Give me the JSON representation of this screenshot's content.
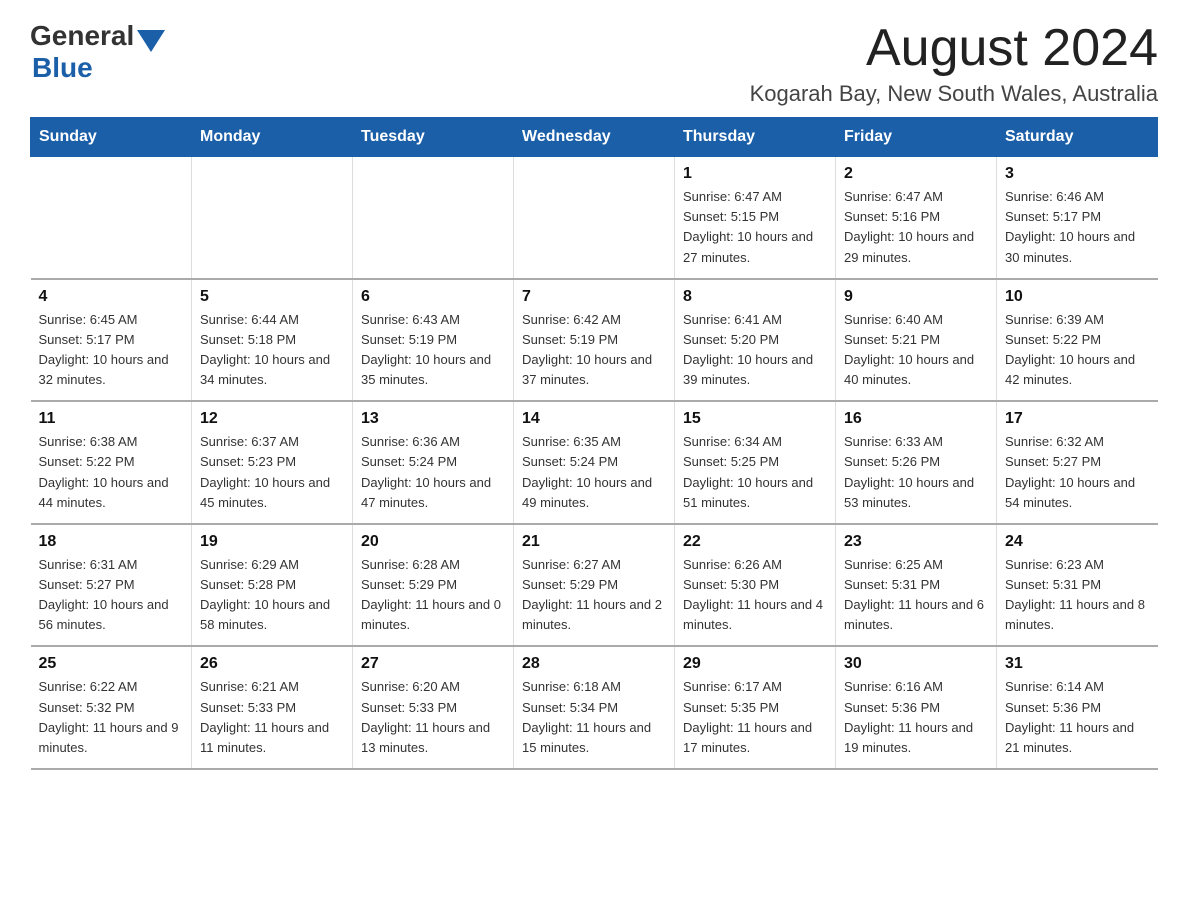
{
  "header": {
    "logo_general": "General",
    "logo_blue": "Blue",
    "month_title": "August 2024",
    "location": "Kogarah Bay, New South Wales, Australia"
  },
  "weekdays": [
    "Sunday",
    "Monday",
    "Tuesday",
    "Wednesday",
    "Thursday",
    "Friday",
    "Saturday"
  ],
  "weeks": [
    [
      {
        "day": "",
        "info": ""
      },
      {
        "day": "",
        "info": ""
      },
      {
        "day": "",
        "info": ""
      },
      {
        "day": "",
        "info": ""
      },
      {
        "day": "1",
        "info": "Sunrise: 6:47 AM\nSunset: 5:15 PM\nDaylight: 10 hours and 27 minutes."
      },
      {
        "day": "2",
        "info": "Sunrise: 6:47 AM\nSunset: 5:16 PM\nDaylight: 10 hours and 29 minutes."
      },
      {
        "day": "3",
        "info": "Sunrise: 6:46 AM\nSunset: 5:17 PM\nDaylight: 10 hours and 30 minutes."
      }
    ],
    [
      {
        "day": "4",
        "info": "Sunrise: 6:45 AM\nSunset: 5:17 PM\nDaylight: 10 hours and 32 minutes."
      },
      {
        "day": "5",
        "info": "Sunrise: 6:44 AM\nSunset: 5:18 PM\nDaylight: 10 hours and 34 minutes."
      },
      {
        "day": "6",
        "info": "Sunrise: 6:43 AM\nSunset: 5:19 PM\nDaylight: 10 hours and 35 minutes."
      },
      {
        "day": "7",
        "info": "Sunrise: 6:42 AM\nSunset: 5:19 PM\nDaylight: 10 hours and 37 minutes."
      },
      {
        "day": "8",
        "info": "Sunrise: 6:41 AM\nSunset: 5:20 PM\nDaylight: 10 hours and 39 minutes."
      },
      {
        "day": "9",
        "info": "Sunrise: 6:40 AM\nSunset: 5:21 PM\nDaylight: 10 hours and 40 minutes."
      },
      {
        "day": "10",
        "info": "Sunrise: 6:39 AM\nSunset: 5:22 PM\nDaylight: 10 hours and 42 minutes."
      }
    ],
    [
      {
        "day": "11",
        "info": "Sunrise: 6:38 AM\nSunset: 5:22 PM\nDaylight: 10 hours and 44 minutes."
      },
      {
        "day": "12",
        "info": "Sunrise: 6:37 AM\nSunset: 5:23 PM\nDaylight: 10 hours and 45 minutes."
      },
      {
        "day": "13",
        "info": "Sunrise: 6:36 AM\nSunset: 5:24 PM\nDaylight: 10 hours and 47 minutes."
      },
      {
        "day": "14",
        "info": "Sunrise: 6:35 AM\nSunset: 5:24 PM\nDaylight: 10 hours and 49 minutes."
      },
      {
        "day": "15",
        "info": "Sunrise: 6:34 AM\nSunset: 5:25 PM\nDaylight: 10 hours and 51 minutes."
      },
      {
        "day": "16",
        "info": "Sunrise: 6:33 AM\nSunset: 5:26 PM\nDaylight: 10 hours and 53 minutes."
      },
      {
        "day": "17",
        "info": "Sunrise: 6:32 AM\nSunset: 5:27 PM\nDaylight: 10 hours and 54 minutes."
      }
    ],
    [
      {
        "day": "18",
        "info": "Sunrise: 6:31 AM\nSunset: 5:27 PM\nDaylight: 10 hours and 56 minutes."
      },
      {
        "day": "19",
        "info": "Sunrise: 6:29 AM\nSunset: 5:28 PM\nDaylight: 10 hours and 58 minutes."
      },
      {
        "day": "20",
        "info": "Sunrise: 6:28 AM\nSunset: 5:29 PM\nDaylight: 11 hours and 0 minutes."
      },
      {
        "day": "21",
        "info": "Sunrise: 6:27 AM\nSunset: 5:29 PM\nDaylight: 11 hours and 2 minutes."
      },
      {
        "day": "22",
        "info": "Sunrise: 6:26 AM\nSunset: 5:30 PM\nDaylight: 11 hours and 4 minutes."
      },
      {
        "day": "23",
        "info": "Sunrise: 6:25 AM\nSunset: 5:31 PM\nDaylight: 11 hours and 6 minutes."
      },
      {
        "day": "24",
        "info": "Sunrise: 6:23 AM\nSunset: 5:31 PM\nDaylight: 11 hours and 8 minutes."
      }
    ],
    [
      {
        "day": "25",
        "info": "Sunrise: 6:22 AM\nSunset: 5:32 PM\nDaylight: 11 hours and 9 minutes."
      },
      {
        "day": "26",
        "info": "Sunrise: 6:21 AM\nSunset: 5:33 PM\nDaylight: 11 hours and 11 minutes."
      },
      {
        "day": "27",
        "info": "Sunrise: 6:20 AM\nSunset: 5:33 PM\nDaylight: 11 hours and 13 minutes."
      },
      {
        "day": "28",
        "info": "Sunrise: 6:18 AM\nSunset: 5:34 PM\nDaylight: 11 hours and 15 minutes."
      },
      {
        "day": "29",
        "info": "Sunrise: 6:17 AM\nSunset: 5:35 PM\nDaylight: 11 hours and 17 minutes."
      },
      {
        "day": "30",
        "info": "Sunrise: 6:16 AM\nSunset: 5:36 PM\nDaylight: 11 hours and 19 minutes."
      },
      {
        "day": "31",
        "info": "Sunrise: 6:14 AM\nSunset: 5:36 PM\nDaylight: 11 hours and 21 minutes."
      }
    ]
  ]
}
